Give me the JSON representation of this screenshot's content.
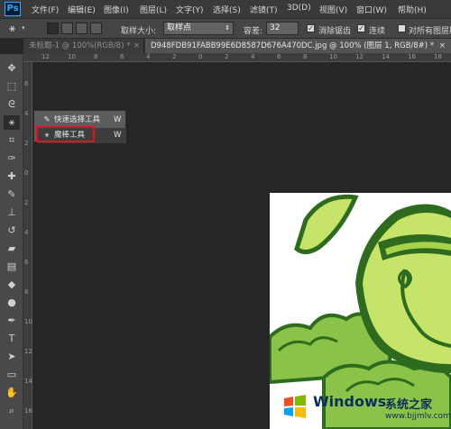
{
  "app": {
    "logo": "Ps"
  },
  "menubar": {
    "items": [
      "文件(F)",
      "编辑(E)",
      "图像(I)",
      "图层(L)",
      "文字(Y)",
      "选择(S)",
      "滤镜(T)",
      "3D(D)",
      "视图(V)",
      "窗口(W)",
      "帮助(H)"
    ]
  },
  "options": {
    "sample_size_label": "取样大小:",
    "sample_size_value": "取样点",
    "tolerance_label": "容差:",
    "tolerance_value": "32",
    "antialias_label": "消除锯齿",
    "antialias_checked": true,
    "contiguous_label": "连续",
    "contiguous_checked": true,
    "all_layers_label": "对所有图层取"
  },
  "tabs": [
    {
      "label": "未标题-1 @ 100%(RGB/8) *",
      "close": "×",
      "active": false
    },
    {
      "label": "D948FDB91FABB99E6D8587D676A470DC.jpg @ 100% (图层 1, RGB/8#) *",
      "close": "×",
      "active": true
    }
  ],
  "ruler": {
    "h_labels": [
      "12",
      "10",
      "8",
      "6",
      "4",
      "2",
      "0",
      "2",
      "4",
      "6",
      "8",
      "10",
      "12",
      "14",
      "16",
      "18"
    ],
    "v_labels": [
      "6",
      "4",
      "2",
      "0",
      "2",
      "4",
      "6",
      "8",
      "10",
      "12",
      "14",
      "16"
    ]
  },
  "flyout": {
    "items": [
      {
        "label": "快速选择工具",
        "shortcut": "W",
        "icon": "quick-selection-icon"
      },
      {
        "label": "魔棒工具",
        "shortcut": "W",
        "icon": "magic-wand-icon"
      }
    ]
  },
  "tools": [
    "move-icon",
    "marquee-icon",
    "lasso-icon",
    "magic-wand-icon",
    "crop-icon",
    "eyedropper-icon",
    "healing-icon",
    "brush-icon",
    "stamp-icon",
    "history-brush-icon",
    "eraser-icon",
    "gradient-icon",
    "blur-icon",
    "dodge-icon",
    "pen-icon",
    "type-icon",
    "path-select-icon",
    "shape-icon",
    "hand-icon",
    "zoom-icon"
  ],
  "watermark": {
    "brand": "Windows",
    "brand_cn": "系统之家",
    "url": "www.bjjmlv.com"
  },
  "colors": {
    "accent_red": "#e0141f",
    "leaf_green": "#8bc34a",
    "leaf_dark": "#2e6b1e",
    "ps_blue": "#31a8ff"
  }
}
